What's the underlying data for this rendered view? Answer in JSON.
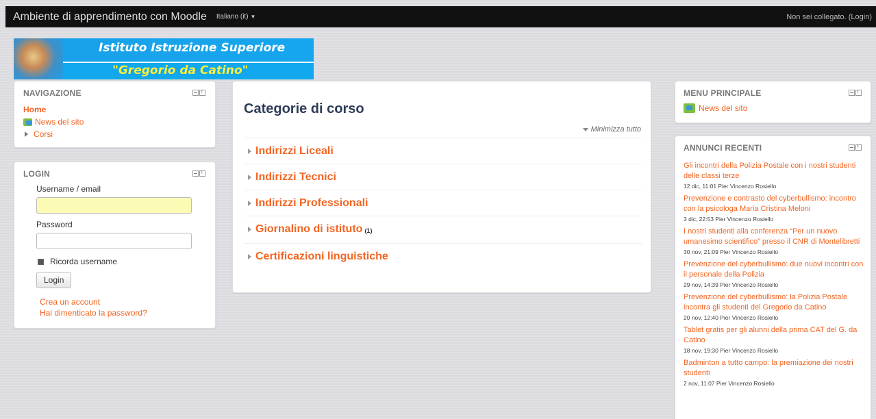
{
  "topbar": {
    "site_name": "Ambiente di apprendimento con Moodle",
    "language": "Italiano (it)",
    "not_logged": "Non sei collegato. (",
    "login_link": "Login",
    "close_paren": ")"
  },
  "logo": {
    "line1": "Istituto Istruzione Superiore",
    "line2": "\"Gregorio da Catino\""
  },
  "navigation": {
    "title": "NAVIGAZIONE",
    "home": "Home",
    "news": "News del sito",
    "courses": "Corsi"
  },
  "login": {
    "title": "LOGIN",
    "username_label": "Username / email",
    "username_value": "",
    "password_label": "Password",
    "password_value": "",
    "remember_label": "Ricorda username",
    "remember_checked": true,
    "button": "Login",
    "create_account": "Crea un account",
    "forgot_password": "Hai dimenticato la password?"
  },
  "main": {
    "title": "Categorie di corso",
    "collapse_all": "Minimizza tutto",
    "categories": [
      {
        "name": "Indirizzi Liceali",
        "count": ""
      },
      {
        "name": "Indirizzi Tecnici",
        "count": ""
      },
      {
        "name": "Indirizzi Professionali",
        "count": ""
      },
      {
        "name": "Giornalino di istituto",
        "count": "(1)"
      },
      {
        "name": "Certificazioni linguistiche",
        "count": ""
      }
    ]
  },
  "main_menu": {
    "title": "MENU PRINCIPALE",
    "news": "News del sito"
  },
  "recent_news": {
    "title": "ANNUNCI RECENTI",
    "items": [
      {
        "title": "Gli incontri della Polizia Postale con i nostri studenti delle classi terze",
        "meta": "12 dic, 11:01  Pier Vincenzo Rosiello"
      },
      {
        "title": "Prevenzione e contrasto del cyberbullismo: incontro con la psicologa Maria Cristina Meloni",
        "meta": "3 dic, 22:53  Pier Vincenzo Rosiello"
      },
      {
        "title": "I nostri studenti alla conferenza “Per un nuovo umanesimo scientifico” presso il CNR di Montelibretti",
        "meta": "30 nov, 21:09  Pier Vincenzo Rosiello"
      },
      {
        "title": "Prevenzione del cyberbullismo: due nuovi incontri con il personale della Polizia",
        "meta": "29 nov, 14:39  Pier Vincenzo Rosiello"
      },
      {
        "title": "Prevenzione del cyberbullismo: la Polizia Postale incontra gli studenti del Gregorio da Catino",
        "meta": "20 nov, 12:40  Pier Vincenzo Rosiello"
      },
      {
        "title": "Tablet gratis per gli alunni della prima CAT del G. da Catino",
        "meta": "18 nov, 19:30  Pier Vincenzo Rosiello"
      },
      {
        "title": "Badminton a tutto campo: la premiazione dei nostri studenti",
        "meta": "2 nov, 11:07  Pier Vincenzo Rosiello"
      }
    ]
  }
}
